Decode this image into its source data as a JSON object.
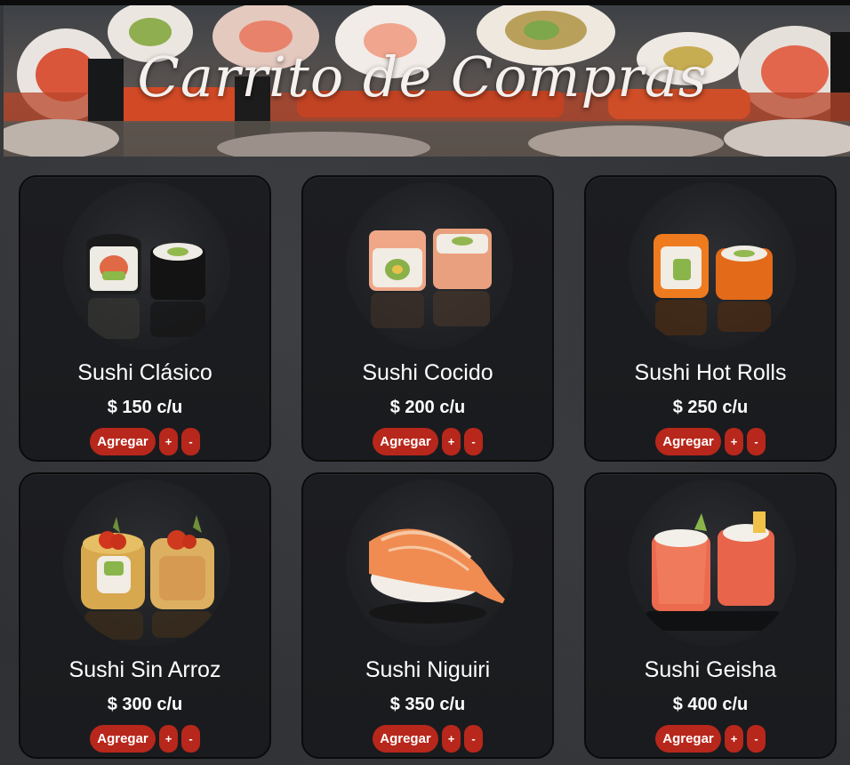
{
  "header": {
    "title": "Carrito de Compras",
    "image": "sushi-banner-image"
  },
  "colors": {
    "button": "#b8271b",
    "card_bg": "#1c1d20",
    "page_bg": "#2b2d30",
    "text": "#ffffff"
  },
  "products": [
    {
      "name": "Sushi Clásico",
      "price": "$ 150 c/u",
      "image": "sushi-clasico-image"
    },
    {
      "name": "Sushi Cocido",
      "price": "$ 200 c/u",
      "image": "sushi-cocido-image"
    },
    {
      "name": "Sushi Hot Rolls",
      "price": "$ 250 c/u",
      "image": "sushi-hot-rolls-image"
    },
    {
      "name": "Sushi Sin Arroz",
      "price": "$ 300 c/u",
      "image": "sushi-sin-arroz-image"
    },
    {
      "name": "Sushi Niguiri",
      "price": "$ 350 c/u",
      "image": "sushi-niguiri-image"
    },
    {
      "name": "Sushi Geisha",
      "price": "$ 400 c/u",
      "image": "sushi-geisha-image"
    }
  ],
  "buttons": {
    "add_label": "Agregar",
    "plus_label": "+",
    "minus_label": "-"
  }
}
